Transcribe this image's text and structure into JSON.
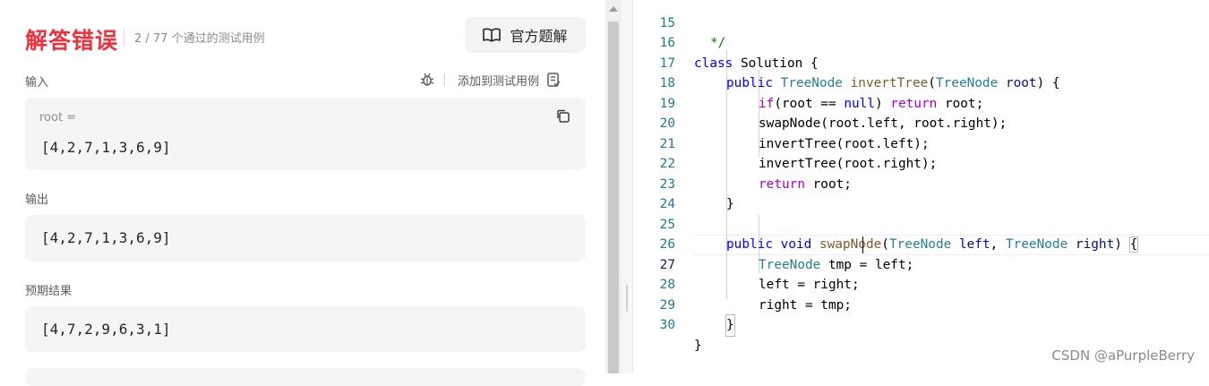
{
  "result": {
    "status": "解答错误",
    "passed_count": "2 / 77 个通过的测试用例",
    "solution_button": "官方题解"
  },
  "input_section": {
    "label": "输入",
    "add_to_testcase": "添加到测试用例",
    "var_name": "root =",
    "value": "[4,2,7,1,3,6,9]"
  },
  "output_section": {
    "label": "输出",
    "value": "[4,2,7,1,3,6,9]"
  },
  "expected_section": {
    "label": "预期结果",
    "value": "[4,7,2,9,6,3,1]"
  },
  "editor": {
    "line_numbers": [
      "15",
      "16",
      "17",
      "18",
      "19",
      "20",
      "21",
      "22",
      "23",
      "24",
      "25",
      "26",
      "27",
      "28",
      "29",
      "30"
    ],
    "lines": {
      "l15": "*/",
      "l16_kw": "class",
      "l16_rest": " Solution {",
      "l17_kw": "public",
      "l17_type": "TreeNode",
      "l17_fn": "invertTree",
      "l17_ptype": "TreeNode",
      "l17_param": "root",
      "l18_cf": "if",
      "l18_a": "(root == ",
      "l18_null": "null",
      "l18_b": ") ",
      "l18_ret": "return",
      "l18_c": " root;",
      "l19": "swapNode(root.left, root.right);",
      "l20": "invertTree(root.left);",
      "l21": "invertTree(root.right);",
      "l22_ret": "return",
      "l22_rest": " root;",
      "l23": "}",
      "l25_kw": "public",
      "l25_void": "void",
      "l25_fn": "swapNode",
      "l25_t1": "TreeNode",
      "l25_p1": "left",
      "l25_t2": "TreeNode",
      "l25_p2": "right",
      "l26_type": "TreeNode",
      "l26_rest": " tmp = left;",
      "l27": "left = right;",
      "l28": "right = tmp;",
      "l29": "}",
      "l30": "}"
    }
  },
  "watermark": "CSDN @aPurpleBerry"
}
